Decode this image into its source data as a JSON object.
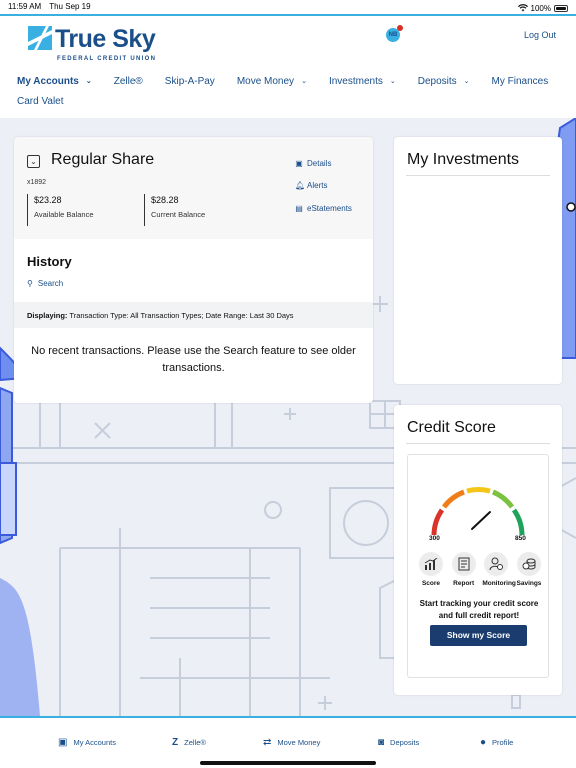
{
  "status_bar": {
    "time": "11:59 AM",
    "date": "Thu Sep 19",
    "battery": "100%"
  },
  "header": {
    "logo_text": "True Sky",
    "logo_subtitle": "FEDERAL CREDIT UNION",
    "notification_initials": "NB",
    "logout_label": "Log Out"
  },
  "nav": {
    "items": [
      {
        "label": "My Accounts"
      },
      {
        "label": "Zelle®"
      },
      {
        "label": "Skip-A-Pay"
      },
      {
        "label": "Move Money"
      },
      {
        "label": "Investments"
      },
      {
        "label": "Deposits"
      },
      {
        "label": "My Finances"
      },
      {
        "label": "Card Valet"
      }
    ]
  },
  "account": {
    "name": "Regular Share",
    "number": "x1892",
    "available_balance": "$23.28",
    "available_label": "Available Balance",
    "current_balance": "$28.28",
    "current_label": "Current Balance",
    "links": {
      "details": "Details",
      "alerts": "Alerts",
      "estatements": "eStatements"
    }
  },
  "history": {
    "title": "History",
    "search_label": "Search",
    "displaying_label": "Displaying:",
    "displaying_value": "Transaction Type: All Transaction Types; Date Range: Last 30 Days",
    "empty_message": "No recent transactions. Please use the Search feature to see older transactions."
  },
  "investments": {
    "title": "My Investments"
  },
  "credit_score": {
    "title": "Credit Score",
    "min": "300",
    "max": "850",
    "features": [
      {
        "label": "Score",
        "icon": "bar-chart-icon"
      },
      {
        "label": "Report",
        "icon": "report-icon"
      },
      {
        "label": "Monitoring",
        "icon": "monitoring-icon"
      },
      {
        "label": "Savings",
        "icon": "savings-icon"
      }
    ],
    "promo_text": "Start tracking your credit score and full credit report!",
    "button_label": "Show my Score"
  },
  "tab_bar": {
    "tabs": [
      {
        "label": "My Accounts",
        "icon": "accounts-icon"
      },
      {
        "label": "Zelle®",
        "icon": "zelle-icon"
      },
      {
        "label": "Move Money",
        "icon": "transfer-icon"
      },
      {
        "label": "Deposits",
        "icon": "camera-icon"
      },
      {
        "label": "Profile",
        "icon": "profile-icon"
      }
    ]
  },
  "colors": {
    "brand": "#1b4f8a",
    "accent": "#3ab0e2",
    "button": "#1b3c6e",
    "background": "#eceff5"
  }
}
